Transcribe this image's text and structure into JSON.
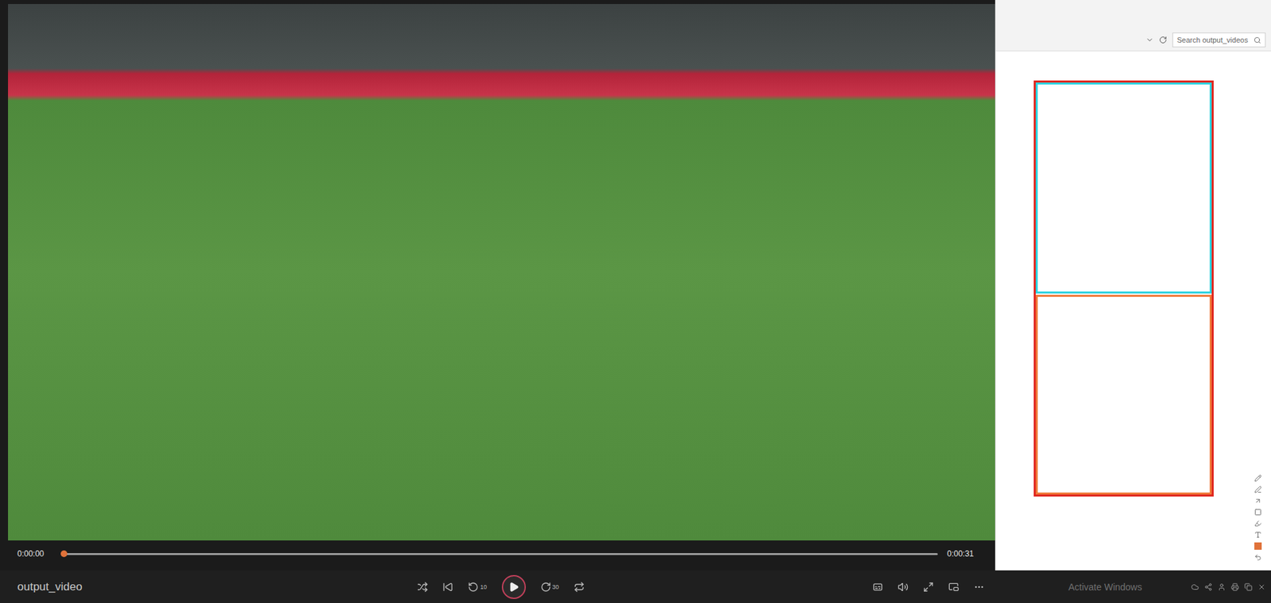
{
  "player": {
    "title": "output_video",
    "current_time": "0:00:00",
    "duration": "0:00:31",
    "progress": 0,
    "playing": false,
    "skip_back": "10",
    "skip_forward": "30"
  },
  "explorer": {
    "search": {
      "placeholder": "Search output_videos"
    }
  },
  "sketch": {
    "shapes": [
      {
        "color": "#e0271f"
      },
      {
        "color": "#2fd3e0"
      },
      {
        "color": "#f07a3a"
      }
    ]
  },
  "watermark": "Activate Windows"
}
